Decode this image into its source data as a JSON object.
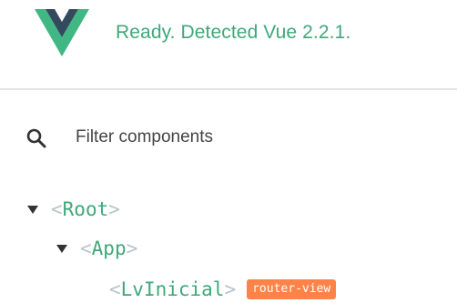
{
  "header": {
    "status_text": "Ready. Detected Vue 2.2.1.",
    "logo_icon": "vue-logo-icon",
    "colors": {
      "vue_green": "#41b883",
      "vue_dark": "#34495e",
      "status_green": "#3fa87a"
    }
  },
  "search": {
    "icon": "search-icon",
    "placeholder": "Filter components",
    "value": ""
  },
  "tree": {
    "nodes": [
      {
        "name": "Root",
        "expanded": true,
        "open_bracket": "<",
        "close_bracket": ">"
      },
      {
        "name": "App",
        "expanded": true,
        "open_bracket": "<",
        "close_bracket": ">"
      },
      {
        "name": "LvInicial",
        "expanded": false,
        "open_bracket": "<",
        "close_bracket": ">",
        "badge": "router-view"
      }
    ],
    "colors": {
      "tag_green": "#3fa87a",
      "bracket_gray": "#b7c3cc",
      "badge_orange": "#ff8347"
    }
  }
}
